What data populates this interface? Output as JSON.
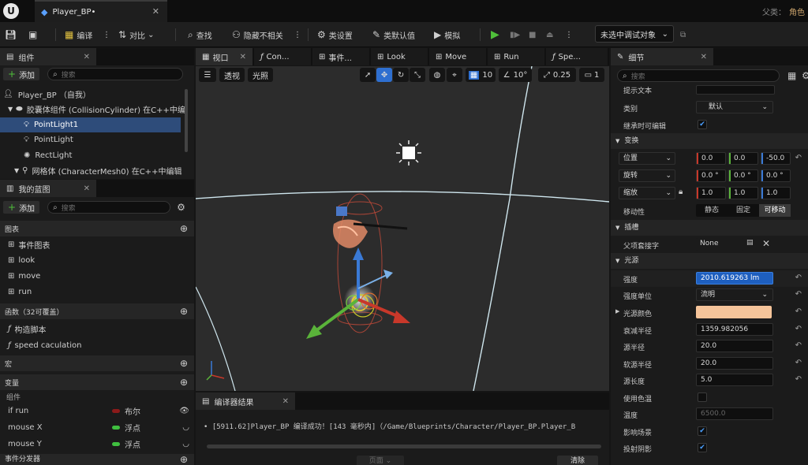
{
  "titlebar": {
    "logo": "U",
    "doc_tab": "Player_BP•",
    "parent_label": "父类：",
    "parent_value": "角色"
  },
  "toolbar": {
    "compile": "编译",
    "diff": "对比",
    "find": "查找",
    "hide_unrelated": "隐藏不相关",
    "class_settings": "类设置",
    "class_defaults": "类默认值",
    "simulate": "模拟",
    "debug_object": "未选中调试对象"
  },
  "components": {
    "tab": "组件",
    "add": "添加",
    "search_placeholder": "搜索",
    "items": [
      {
        "label": "Player_BP （自我）"
      },
      {
        "label": "胶囊体组件 (CollisionCylinder)  在C++中编"
      },
      {
        "label": "PointLight1"
      },
      {
        "label": "PointLight"
      },
      {
        "label": "RectLight"
      },
      {
        "label": "网格体 (CharacterMesh0)  在C++中编辑"
      }
    ]
  },
  "blueprint": {
    "tab": "我的蓝图",
    "add": "添加",
    "search_placeholder": "搜索",
    "graphs_header": "图表",
    "graphs": [
      "事件图表",
      "look",
      "move",
      "run"
    ],
    "functions_header": "函数（32可覆盖）",
    "functions": [
      "构造脚本",
      "speed caculation"
    ],
    "macros_header": "宏",
    "variables_header": "变量",
    "components_sub": "组件",
    "variables": [
      {
        "name": "if run",
        "type": "布尔",
        "color": "#8b1a1a"
      },
      {
        "name": "mouse X",
        "type": "浮点",
        "color": "#3fbf3f"
      },
      {
        "name": "mouse Y",
        "type": "浮点",
        "color": "#3fbf3f"
      }
    ],
    "dispatchers_header": "事件分发器"
  },
  "center_tabs": [
    "视口",
    "Con...",
    "事件...",
    "Look",
    "Move",
    "Run",
    "Spe..."
  ],
  "viewport": {
    "perspective": "透视",
    "lit": "光照",
    "grid_snap": "10",
    "rot_snap": "10°",
    "scale_snap": "0.25",
    "camera_speed": "1"
  },
  "compiler": {
    "tab": "编译器结果",
    "log": "[5911.62]Player_BP 编译成功！[143 毫秒内]（/Game/Blueprints/Character/Player_BP.Player_B",
    "page_label": "页面",
    "clear": "清除"
  },
  "details": {
    "tab": "细节",
    "search_placeholder": "搜索",
    "tooltip_label": "提示文本",
    "category_label": "类别",
    "category_value": "默认",
    "editable_label": "继承时可编辑",
    "transform_header": "变换",
    "location_label": "位置",
    "location": [
      "0.0",
      "0.0",
      "-50.0"
    ],
    "rotation_label": "旋转",
    "rotation": [
      "0.0 °",
      "0.0 °",
      "0.0 °"
    ],
    "scale_label": "缩放",
    "scale": [
      "1.0",
      "1.0",
      "1.0"
    ],
    "mobility_label": "移动性",
    "mobility": [
      "静态",
      "固定",
      "可移动"
    ],
    "socket_header": "插槽",
    "parent_socket_label": "父项套接字",
    "parent_socket_value": "None",
    "light_header": "光源",
    "intensity_label": "强度",
    "intensity_value": "2010.619263 lm",
    "intensity_unit_label": "强度单位",
    "intensity_unit_value": "流明",
    "light_color_label": "光源颜色",
    "light_color": "#f5c49a",
    "attenuation_label": "衰减半径",
    "attenuation_value": "1359.982056",
    "source_radius_label": "源半径",
    "source_radius_value": "20.0",
    "soft_radius_label": "软源半径",
    "soft_radius_value": "20.0",
    "source_length_label": "源长度",
    "source_length_value": "5.0",
    "use_temp_label": "使用色温",
    "temperature_label": "温度",
    "temperature_value": "6500.0",
    "affects_world_label": "影响场景",
    "cast_shadows_label": "投射阴影"
  }
}
